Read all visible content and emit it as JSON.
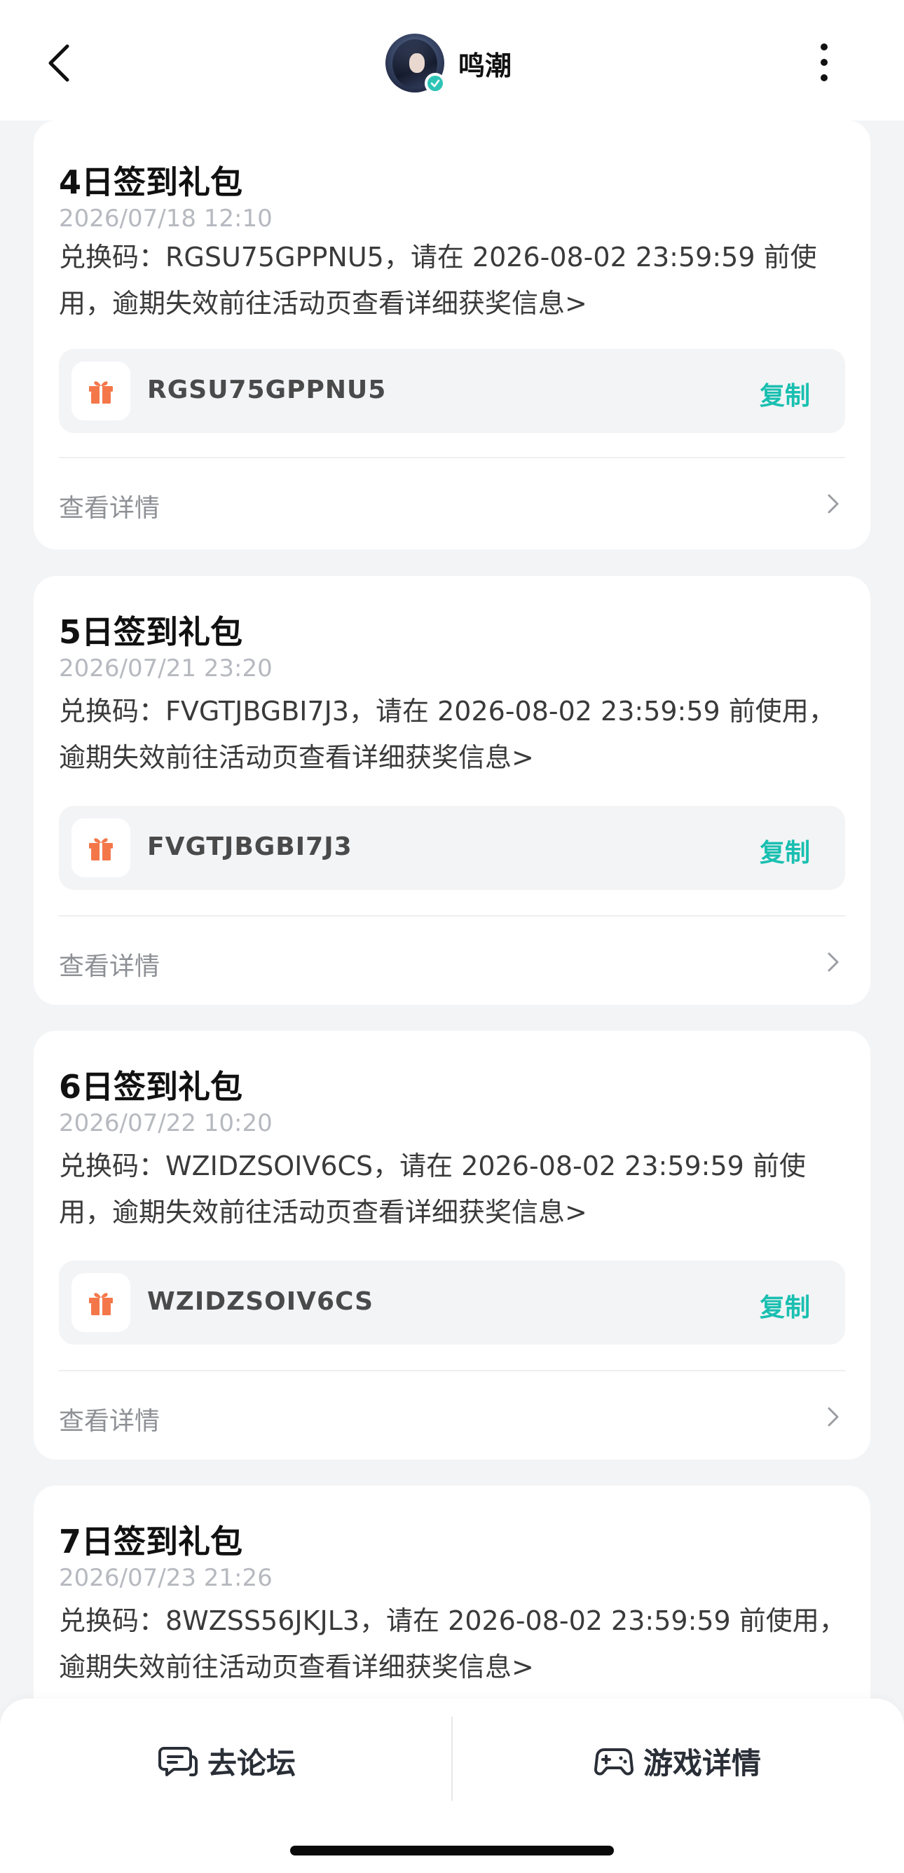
{
  "header": {
    "title": "鸣潮",
    "back_icon": "chevron-left-icon",
    "more_icon": "more-vertical-icon",
    "verify_badge_icon": "check-badge-icon"
  },
  "colors": {
    "accent": "#19bfb0",
    "gift_orange": "#f4774a",
    "page_bg": "#f3f4f6"
  },
  "cards": [
    {
      "title": "4日签到礼包",
      "date": "2026/07/18 12:10",
      "desc": "兑换码：RGSU75GPPNU5，请在 2026-08-02 23:59:59 前使用，逾期失效前往活动页查看详细获奖信息>",
      "code": "RGSU75GPPNU5",
      "copy_label": "复制",
      "detail_label": "查看详情"
    },
    {
      "title": "5日签到礼包",
      "date": "2026/07/21 23:20",
      "desc": "兑换码：FVGTJBGBI7J3，请在 2026-08-02 23:59:59 前使用，逾期失效前往活动页查看详细获奖信息>",
      "code": "FVGTJBGBI7J3",
      "copy_label": "复制",
      "detail_label": "查看详情"
    },
    {
      "title": "6日签到礼包",
      "date": "2026/07/22 10:20",
      "desc": "兑换码：WZIDZSOIV6CS，请在 2026-08-02 23:59:59 前使用，逾期失效前往活动页查看详细获奖信息>",
      "code": "WZIDZSOIV6CS",
      "copy_label": "复制",
      "detail_label": "查看详情"
    },
    {
      "title": "7日签到礼包",
      "date": "2026/07/23 21:26",
      "desc": "兑换码：8WZSS56JKJL3，请在 2026-08-02 23:59:59 前使用，逾期失效前往活动页查看详细获奖信息>"
    }
  ],
  "bottom_bar": {
    "forum_label": "去论坛",
    "forum_icon": "chat-bubble-icon",
    "game_label": "游戏详情",
    "game_icon": "gamepad-icon"
  }
}
